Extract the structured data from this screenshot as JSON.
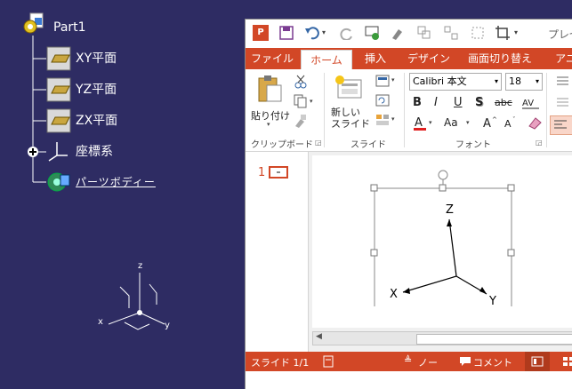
{
  "tree": {
    "root": "Part1",
    "items": [
      "XY平面",
      "YZ平面",
      "ZX平面",
      "座標系",
      "パーツボディー"
    ]
  },
  "axes_small": {
    "z": "z",
    "x": "x",
    "y": "y"
  },
  "ppt": {
    "title_partial": "プレゼ",
    "tabs": [
      "ファイル",
      "ホーム",
      "挿入",
      "デザイン",
      "画面切り替え",
      "アニ"
    ],
    "paste": "貼り付け",
    "new_slide": "新しい\nスライド",
    "font_name": "Calibri 本文",
    "font_size": "18",
    "bold": "B",
    "italic": "I",
    "underline": "U",
    "shadow": "S",
    "strike": "abc",
    "groups": {
      "clipboard": "クリップボード",
      "slides": "スライド",
      "font": "フォント"
    },
    "slide_number": "1",
    "slide_axes": {
      "z": "Z",
      "x": "X",
      "y": "Y"
    },
    "status": {
      "slide": "スライド 1/1",
      "notes": "ノート",
      "comments": "コメント"
    }
  },
  "colors": {
    "bg": "#2e2c63",
    "accent": "#d24726"
  }
}
